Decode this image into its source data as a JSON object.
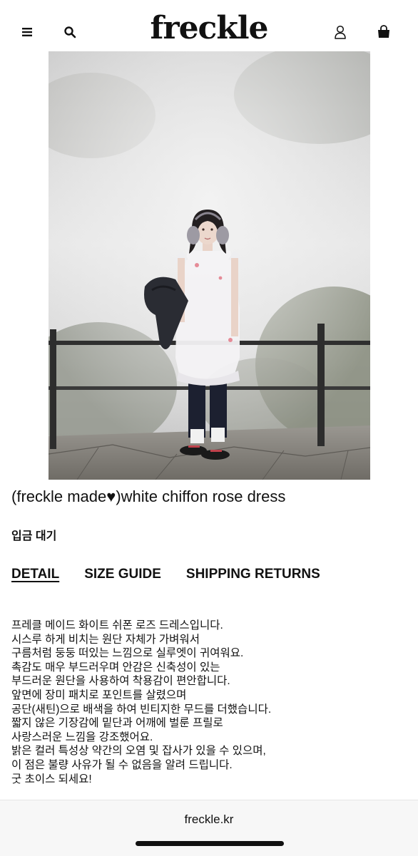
{
  "header": {
    "logo": "freckle",
    "menu_icon": "hamburger-menu-icon",
    "search_icon": "search-icon",
    "account_icon": "user-icon",
    "cart_icon": "shopping-bag-icon"
  },
  "product": {
    "title": "(freckle made♥)white chiffon rose dress",
    "stock_status": "입금 대기",
    "image_alt": ""
  },
  "tabs": [
    {
      "label": "DETAIL",
      "active": true
    },
    {
      "label": "SIZE GUIDE",
      "active": false
    },
    {
      "label": "SHIPPING RETURNS",
      "active": false
    }
  ],
  "description": [
    "프레클 메이드 화이트 쉬폰 로즈 드레스입니다.",
    "시스루 하게 비치는 원단 자체가 가벼워서",
    "구름처럼 둥둥 떠있는 느낌으로 실루엣이 귀여워요.",
    "촉감도 매우 부드러우며 안감은 신축성이 있는",
    "부드러운 원단을 사용하여 착용감이 편안합니다.",
    "앞면에 장미 패치로 포인트를 살렸으며",
    "공단(새틴)으로 배색을 하여 빈티지한 무드를 더했습니다.",
    "짧지 않은 기장감에 밑단과 어깨에 벌룬 프릴로",
    "사랑스러운 느낌을 강조했어요.",
    "밝은 컬러 특성상 약간의 오염 및 잡사가 있을 수 있으며,",
    "이 점은 불량 사유가 될 수 없음을 알려 드립니다.",
    "굿 초이스 되세요!"
  ],
  "footer": {
    "url": "freckle.kr"
  }
}
